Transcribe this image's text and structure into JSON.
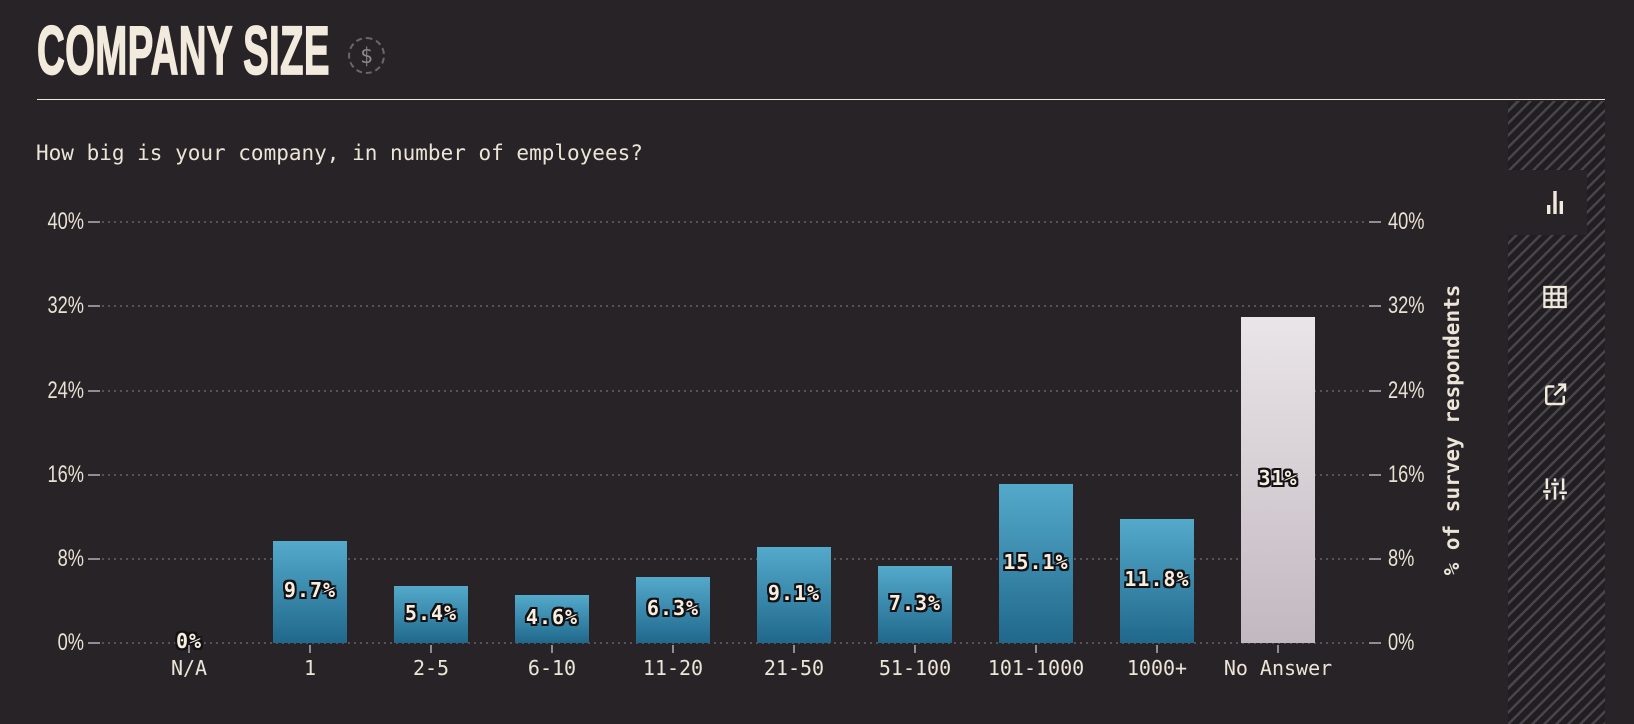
{
  "header": {
    "title": "COMPANY SIZE",
    "currency_symbol": "$"
  },
  "question": "How big is your company, in number of employees?",
  "chart_data": {
    "type": "bar",
    "categories": [
      "N/A",
      "1",
      "2-5",
      "6-10",
      "11-20",
      "21-50",
      "51-100",
      "101-1000",
      "1000+",
      "No Answer"
    ],
    "values": [
      0,
      9.7,
      5.4,
      4.6,
      6.3,
      9.1,
      7.3,
      15.1,
      11.8,
      31
    ],
    "value_labels": [
      "0%",
      "9.7%",
      "5.4%",
      "4.6%",
      "6.3%",
      "9.1%",
      "7.3%",
      "15.1%",
      "11.8%",
      "31%"
    ],
    "title": "",
    "xlabel": "",
    "ylabel": "% of survey respondents",
    "ylim": [
      0,
      40
    ],
    "yticks": [
      0,
      8,
      16,
      24,
      32,
      40
    ],
    "ytick_labels": [
      "0%",
      "8%",
      "16%",
      "24%",
      "32%",
      "40%"
    ],
    "ytick_labels_sides": "both",
    "grid": "dotted horizontal",
    "legend": "none",
    "highlight_category": "No Answer",
    "bar_gradient_default": [
      "#54aacb",
      "#20688c"
    ],
    "bar_gradient_highlight": [
      "#eae5e8",
      "#c2b9c0"
    ]
  },
  "sidebar": {
    "items": [
      {
        "icon": "bar-chart-icon",
        "label": "chart view",
        "active": true
      },
      {
        "icon": "table-icon",
        "label": "table view",
        "active": false
      },
      {
        "icon": "external-link-icon",
        "label": "open external",
        "active": false
      },
      {
        "icon": "sliders-icon",
        "label": "filters",
        "active": false
      }
    ]
  },
  "colors": {
    "background": "#272327",
    "text_cream": "#ece5d7",
    "title_cream": "#f2ebdd",
    "grid_dot": "#57525a",
    "tick_dash": "#908c92",
    "rule": "#efe8da",
    "hatch_dark": "#211e21",
    "hatch_light": "#49444b",
    "value_label_fill": "#f6efe0",
    "value_label_outline": "#141114"
  }
}
